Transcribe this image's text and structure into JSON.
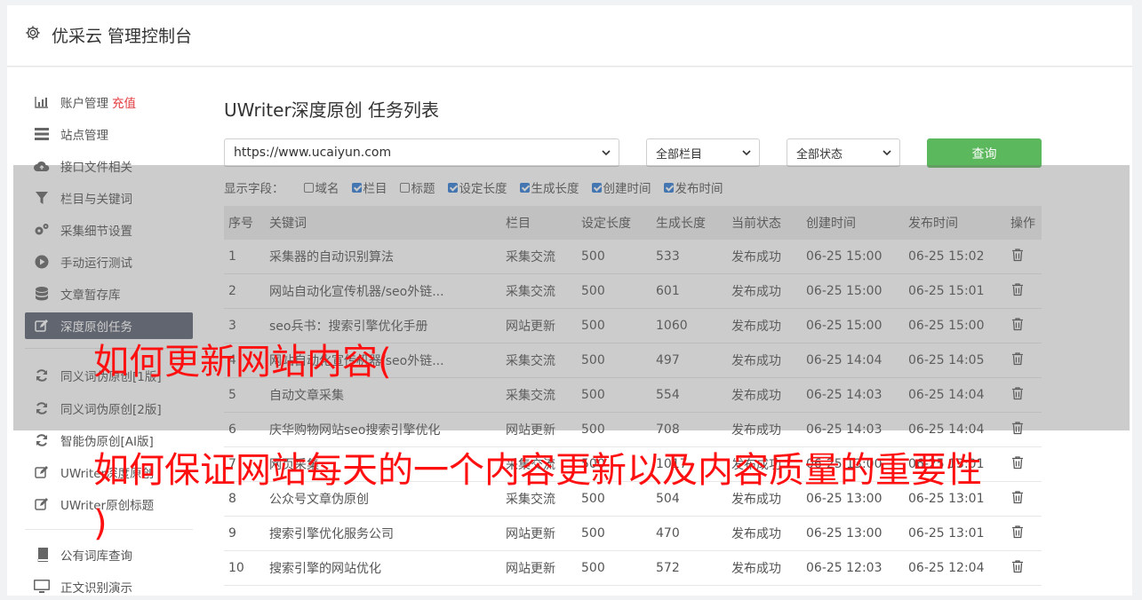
{
  "header": {
    "title": "优采云 管理控制台",
    "icon": "gear-icon"
  },
  "sidebar": {
    "items": [
      {
        "label": "账户管理",
        "extra": "充值",
        "icon": "bar-chart-icon"
      },
      {
        "label": "站点管理",
        "icon": "list-icon"
      },
      {
        "label": "接口文件相关",
        "icon": "cloud-upload-icon"
      },
      {
        "label": "栏目与关键词",
        "icon": "filter-icon"
      },
      {
        "label": "采集细节设置",
        "icon": "cogs-icon"
      },
      {
        "label": "手动运行测试",
        "icon": "play-circle-icon"
      },
      {
        "label": "文章暂存库",
        "icon": "database-icon"
      },
      {
        "label": "深度原创任务",
        "icon": "edit-icon",
        "active": true
      },
      {
        "label": "同义词伪原创[1版]",
        "icon": "refresh-icon"
      },
      {
        "label": "同义词伪原创[2版]",
        "icon": "refresh-icon"
      },
      {
        "label": "智能伪原创[AI版]",
        "icon": "refresh-icon"
      },
      {
        "label": "UWriter深度原创",
        "icon": "edit-icon"
      },
      {
        "label": "UWriter原创标题",
        "icon": "edit-icon"
      },
      {
        "label": "公有词库查询",
        "icon": "book-icon"
      },
      {
        "label": "正文识别演示",
        "icon": "monitor-icon"
      }
    ]
  },
  "main": {
    "title": "UWriter深度原创 任务列表",
    "filters": {
      "site": "https://www.ucaiyun.com",
      "column": "全部栏目",
      "status": "全部状态",
      "query_label": "查询"
    },
    "display_fields": {
      "label": "显示字段：",
      "fields": [
        {
          "label": "域名",
          "checked": false
        },
        {
          "label": "栏目",
          "checked": true
        },
        {
          "label": "标题",
          "checked": false
        },
        {
          "label": "设定长度",
          "checked": true
        },
        {
          "label": "生成长度",
          "checked": true
        },
        {
          "label": "创建时间",
          "checked": true
        },
        {
          "label": "发布时间",
          "checked": true
        }
      ]
    },
    "table": {
      "headers": [
        "序号",
        "关键词",
        "栏目",
        "设定长度",
        "生成长度",
        "当前状态",
        "创建时间",
        "发布时间",
        "操作"
      ],
      "rows": [
        [
          "1",
          "采集器的自动识别算法",
          "采集交流",
          "500",
          "533",
          "发布成功",
          "06-25 15:00",
          "06-25 15:02"
        ],
        [
          "2",
          "网站自动化宣传机器/seo外链...",
          "采集交流",
          "500",
          "601",
          "发布成功",
          "06-25 15:00",
          "06-25 15:01"
        ],
        [
          "3",
          "seo兵书：搜索引擎优化手册",
          "网站更新",
          "500",
          "1060",
          "发布成功",
          "06-25 15:00",
          "06-25 15:00"
        ],
        [
          "4",
          "网站自动化宣传机器/seo外链...",
          "采集交流",
          "500",
          "497",
          "发布成功",
          "06-25 14:04",
          "06-25 14:05"
        ],
        [
          "5",
          "自动文章采集",
          "采集交流",
          "500",
          "554",
          "发布成功",
          "06-25 14:03",
          "06-25 14:04"
        ],
        [
          "6",
          "庆华购物网站seo搜索引擎优化",
          "网站更新",
          "500",
          "708",
          "发布成功",
          "06-25 14:03",
          "06-25 14:04"
        ],
        [
          "7",
          "网页采集",
          "采集交流",
          "500",
          "1017",
          "发布成功",
          "06-25 13:00",
          "06-25 13:01"
        ],
        [
          "8",
          "公众号文章伪原创",
          "采集交流",
          "500",
          "504",
          "发布成功",
          "06-25 13:00",
          "06-25 13:01"
        ],
        [
          "9",
          "搜索引擎优化服务公司",
          "网站更新",
          "500",
          "470",
          "发布成功",
          "06-25 13:00",
          "06-25 13:01"
        ],
        [
          "10",
          "搜索引擎的网站优化",
          "网站更新",
          "500",
          "572",
          "发布成功",
          "06-25 12:03",
          "06-25 12:04"
        ]
      ]
    }
  },
  "overlay": {
    "line1": "如何更新网站内容(",
    "line2": "如何保证网站每天的一个内容更新以及内容质量的重要性",
    "line3": ")"
  },
  "colors": {
    "accent_green": "#5cb85c",
    "active_nav": "#5b6270",
    "status_ok": "#2e9a2e",
    "overlay_red": "#ff1010"
  }
}
